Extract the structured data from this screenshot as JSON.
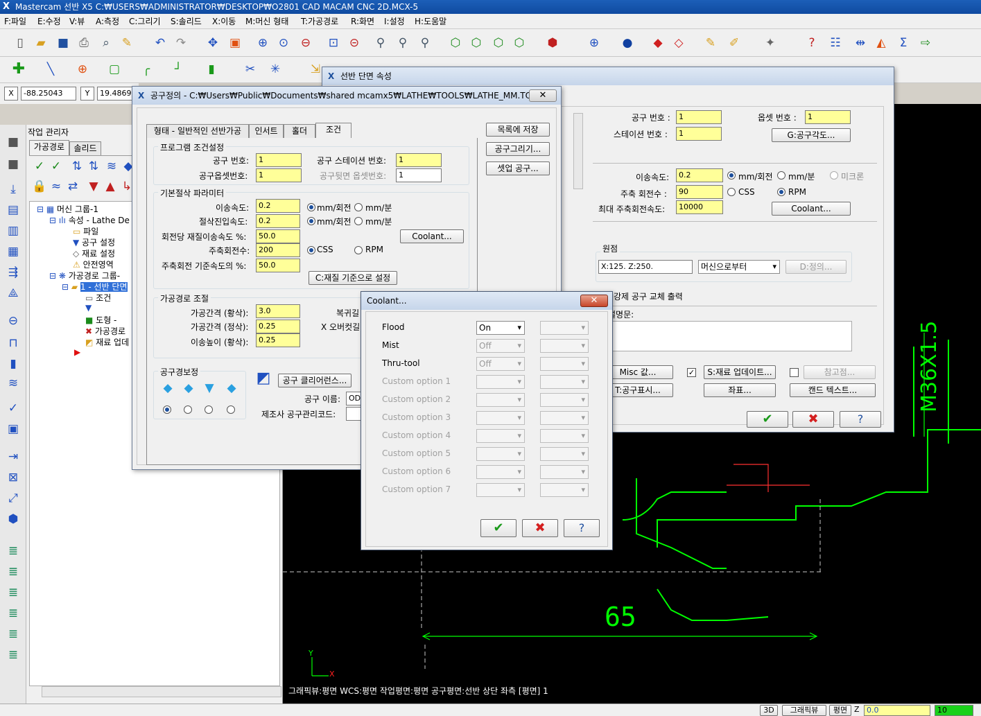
{
  "app": {
    "title": "Mastercam 선반 X5   C:₩USERS₩ADMINISTRATOR₩DESKTOP₩O2801 CAD MACAM CNC 2D.MCX-5"
  },
  "menu": [
    "F:파일",
    "E:수정",
    "V:뷰",
    "A:측정",
    "C:그리기",
    "S:솔리드",
    "X:이동",
    "M:머신 형태",
    "T:가공경로",
    "R:화면",
    "I:설정",
    "H:도움말"
  ],
  "coords": {
    "x_label": "X",
    "x_value": "-88.25043",
    "y_label": "Y",
    "y_value": "19.48692"
  },
  "manager": {
    "title": "작업 관리자",
    "tabs": [
      "가공경로",
      "솔리드"
    ],
    "tree": [
      "머신 그룹-1",
      "속성 - Lathe De",
      "파일",
      "공구 설정",
      "재료 설정",
      "안전영역",
      "가공경로 그룹-",
      "1 - 선반 단면",
      "조건",
      "도형 -",
      "가공경로",
      "재료 업데"
    ]
  },
  "status": {
    "text": "그래픽뷰:평면   WCS:평면   작업평면:평면   공구평면:선반 상단 좌측 [평면] 1",
    "view3d": "3D",
    "graphics": "그래픽뷰",
    "plane": "평면",
    "z_label": "Z",
    "z_value": "0.0",
    "level": "10"
  },
  "cad": {
    "dim_65": "65",
    "dim_thread": "M36X1.5",
    "axis_y": "Y",
    "axis_x": "X"
  },
  "face_dialog": {
    "title": "선반 단면 속성",
    "tool_no_label": "공구 번호 :",
    "tool_no": "1",
    "offset_no_label": "옵셋 번호 :",
    "offset_no": "1",
    "station_label": "스테이션 번호 :",
    "station": "1",
    "angle_btn": "G:공구각도...",
    "feed_label": "이송속도:",
    "feed": "0.2",
    "feed_units": [
      "mm/회전",
      "mm/분",
      "미크론"
    ],
    "spindle_label": "주축 회전수 :",
    "spindle": "90",
    "spindle_units": [
      "CSS",
      "RPM"
    ],
    "max_spindle_label": "최대 주축회전속도:",
    "max_spindle": "10000",
    "coolant_btn": "Coolant...",
    "home_label": "원점",
    "home_value": "X:125.  Z:250.",
    "home_select": "머신으로부터",
    "define_btn": "D:정의...",
    "force_tool_label": "강제 공구 교체 출력",
    "comment_label": "설명문:",
    "misc_btn": "Misc 값...",
    "stock_btn": "S:재료 업데이트...",
    "ref_btn": "참고점...",
    "tooldisp_btn": "T:공구표시...",
    "coord_btn": "좌표...",
    "canned_btn": "캔드 텍스트..."
  },
  "tool_dialog": {
    "title": "공구정의 - C:₩Users₩Public₩Documents₩shared mcamx5₩LATHE₩TOOLS₩LATHE_MM.TOOLS-5",
    "tabs": [
      "형태 - 일반적인 선반가공",
      "인서트",
      "홀더",
      "조건"
    ],
    "side_btns": [
      "목록에 저장",
      "공구그리기...",
      "셋업 공구..."
    ],
    "prog_group": "프로그램 조건설정",
    "tool_no_label": "공구 번호:",
    "tool_no": "1",
    "station_label": "공구 스테이션 번호:",
    "station": "1",
    "offset_label": "공구옵셋번호:",
    "offset": "1",
    "back_offset_label": "공구뒷면 옵셋번호:",
    "back_offset": "1",
    "cut_group": "기본절삭 파라미터",
    "feed_label": "이송속도:",
    "feed": "0.2",
    "plunge_label": "절삭진입속도:",
    "plunge": "0.2",
    "unit_a": "mm/회전",
    "unit_b": "mm/분",
    "surf_label": "회전당 재질이송속도 %:",
    "surf": "50.0",
    "coolant_btn": "Coolant...",
    "spindle_label": "주축회전수:",
    "spindle": "200",
    "css": "CSS",
    "rpm": "RPM",
    "spindle_pct_label": "주축회전 기준속도의 %:",
    "spindle_pct": "50.0",
    "material_btn": "C:재질 기준으로 설정",
    "path_group": "가공경로 조절",
    "rough_step_label": "가공간격 (황삭):",
    "rough_step": "3.0",
    "finish_step_label": "가공간격 (정삭):",
    "finish_step": "0.25",
    "retract_label": "이송높이 (황삭):",
    "retract": "0.25",
    "return_label": "복귀길",
    "xover_label": "X 오버컷길",
    "comp_group": "공구경보정",
    "clearance_btn": "공구 클리어런스...",
    "tool_name_label": "공구 이름:",
    "tool_name": "OD",
    "mfr_label": "제조사 공구관리코드:"
  },
  "coolant": {
    "title": "Coolant...",
    "rows": [
      {
        "label": "Flood",
        "value": "On",
        "enabled": true
      },
      {
        "label": "Mist",
        "value": "Off",
        "enabled": true
      },
      {
        "label": "Thru-tool",
        "value": "Off",
        "enabled": true
      },
      {
        "label": "Custom option 1",
        "value": "",
        "enabled": false
      },
      {
        "label": "Custom option 2",
        "value": "",
        "enabled": false
      },
      {
        "label": "Custom option 3",
        "value": "",
        "enabled": false
      },
      {
        "label": "Custom option 4",
        "value": "",
        "enabled": false
      },
      {
        "label": "Custom option 5",
        "value": "",
        "enabled": false
      },
      {
        "label": "Custom option 6",
        "value": "",
        "enabled": false
      },
      {
        "label": "Custom option 7",
        "value": "",
        "enabled": false
      }
    ]
  },
  "colors": {
    "accent": "#1c5fb8",
    "cad_green": "#00ff00",
    "field_yellow": "#ffff99",
    "ok_green": "#1a9a1a",
    "cancel_red": "#d42020"
  }
}
